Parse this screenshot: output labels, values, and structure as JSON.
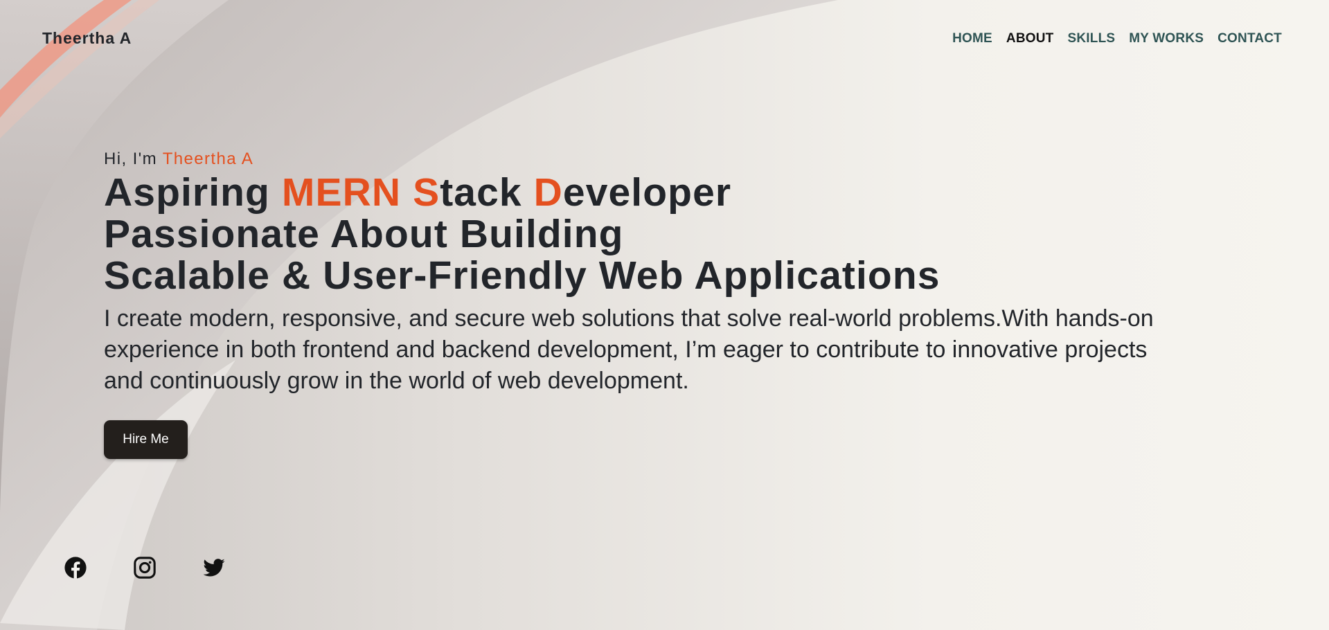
{
  "brand": {
    "name": "Theertha A"
  },
  "nav": {
    "items": [
      {
        "label": "HOME",
        "active": false
      },
      {
        "label": "ABOUT",
        "active": true
      },
      {
        "label": "SKILLS",
        "active": false
      },
      {
        "label": "MY WORKS",
        "active": false
      },
      {
        "label": "CONTACT",
        "active": false
      }
    ]
  },
  "hero": {
    "greeting_prefix": "Hi, I'm ",
    "greeting_name": "Theertha A",
    "headline": {
      "line1": {
        "p1": "Aspiring ",
        "a1": "MERN S",
        "p2": "tack ",
        "a2": "D",
        "p3": "eveloper"
      },
      "line2": "Passionate About Building",
      "line3": "Scalable & User-Friendly Web Applications"
    },
    "description": "I create modern, responsive, and secure web solutions that solve real-world problems.With hands-on experience in both frontend and backend development, I’m eager to contribute to innovative projects and continuously grow in the world of web development.",
    "cta_label": "Hire Me"
  },
  "social": {
    "icons": [
      "facebook-icon",
      "instagram-icon",
      "twitter-icon"
    ]
  },
  "colors": {
    "accent": "#e4501f",
    "text": "#22252a",
    "nav": "#2f5454",
    "nav_active": "#111111",
    "button_bg": "#231f1c",
    "background": "#f4f2ee"
  }
}
